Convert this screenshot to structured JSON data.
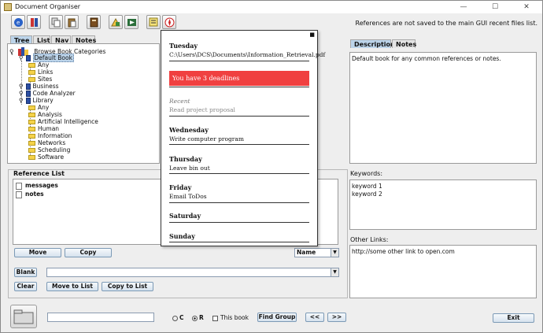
{
  "window": {
    "title": "Document Organiser",
    "controls": [
      "—",
      "☐",
      "✕"
    ]
  },
  "toolbar": {
    "message": "References are not saved to the main GUI recent files list.",
    "buttons": [
      "web-icon",
      "book-icon",
      "copy-icon",
      "paste-icon",
      "notebook-icon",
      "edit-icon",
      "media-icon",
      "notes-icon",
      "compass-icon"
    ]
  },
  "left_tabs": [
    "Tree",
    "List",
    "Nav",
    "Notes"
  ],
  "tree": {
    "root": "Browse Book Categories",
    "nodes": [
      {
        "label": "Default Book",
        "kind": "book",
        "level": 1,
        "selected": true
      },
      {
        "label": "Any",
        "kind": "folder",
        "level": 2
      },
      {
        "label": "Links",
        "kind": "folder",
        "level": 2
      },
      {
        "label": "Sites",
        "kind": "folder",
        "level": 2
      },
      {
        "label": "Business",
        "kind": "book",
        "level": 1
      },
      {
        "label": "Code Analyzer",
        "kind": "book",
        "level": 1
      },
      {
        "label": "Library",
        "kind": "book",
        "level": 1
      },
      {
        "label": "Any",
        "kind": "folder",
        "level": 2
      },
      {
        "label": "Analysis",
        "kind": "folder",
        "level": 2
      },
      {
        "label": "Artificial Intelligence",
        "kind": "folder",
        "level": 2
      },
      {
        "label": "Human",
        "kind": "folder",
        "level": 2
      },
      {
        "label": "Information",
        "kind": "folder",
        "level": 2
      },
      {
        "label": "Networks",
        "kind": "folder",
        "level": 2
      },
      {
        "label": "Scheduling",
        "kind": "folder",
        "level": 2
      },
      {
        "label": "Software",
        "kind": "folder",
        "level": 2
      }
    ]
  },
  "reference_list": {
    "title": "Reference List",
    "items": [
      "messages",
      "notes"
    ],
    "move_label": "Move",
    "copy_label": "Copy",
    "sort_value": "Name",
    "blank_label": "Blank",
    "clear_label": "Clear",
    "move_to_list_label": "Move to List",
    "copy_to_list_label": "Copy to List"
  },
  "right_tabs": [
    "Description",
    "Notes"
  ],
  "description": "Default book for any common references or notes.",
  "keywords": {
    "label": "Keywords:",
    "items": [
      "keyword 1",
      "keyword 2"
    ]
  },
  "other_links": {
    "label": "Other Links:",
    "items": [
      "http://some other link to open.com"
    ]
  },
  "bottom": {
    "radio_c": "C",
    "radio_r": "R",
    "this_book": "This book",
    "find_group": "Find Group",
    "prev": "<<",
    "next": ">>",
    "exit": "Exit"
  },
  "popup": {
    "close": "■",
    "day1": "Tuesday",
    "path": "C:\\Users\\DCS\\Documents\\Information_Retrieval.pdf",
    "deadline": "You have 3 deadlines",
    "recent_label": "Recent",
    "recent_item": "Read project proposal",
    "day2": "Wednesday",
    "day2_item": "Write computer program",
    "day3": "Thursday",
    "day3_item": "Leave bin out",
    "day4": "Friday",
    "day4_item": "Email ToDos",
    "day5": "Saturday",
    "day6": "Sunday"
  },
  "colors": {
    "deadline": "#f04040",
    "selection": "#bcd4ea"
  }
}
